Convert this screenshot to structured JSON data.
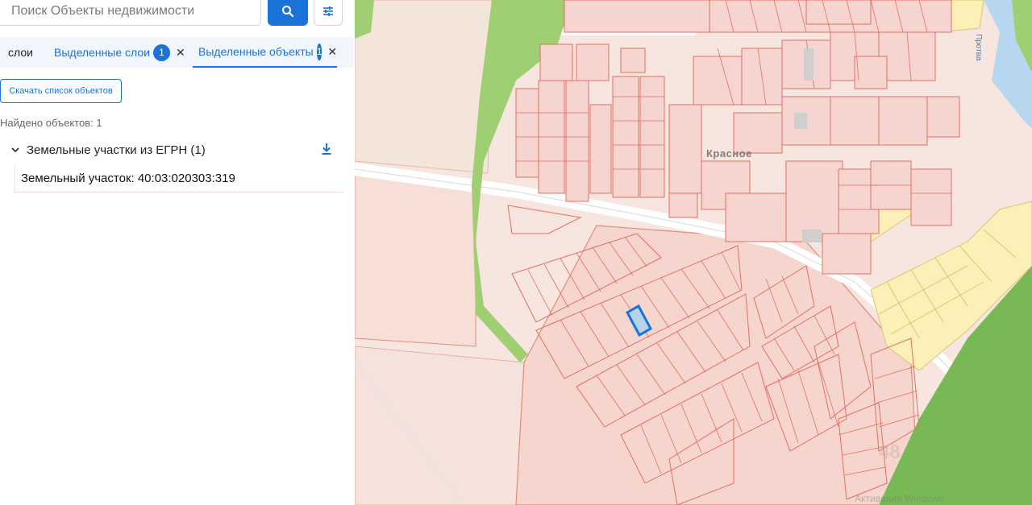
{
  "search": {
    "placeholder": "Поиск Объекты недвижимости"
  },
  "tabs": [
    {
      "label": "слои"
    },
    {
      "label": "Выделенные слои",
      "badge": "1"
    },
    {
      "label": "Выделенные объекты",
      "badge": "1"
    }
  ],
  "actions": {
    "download_list_label": "Скачать список объектов"
  },
  "results": {
    "found_text": "Найдено объектов: 1",
    "group": {
      "title": "Земельные участки из ЕГРН (1)"
    },
    "items": [
      {
        "label": "Земельный участок: 40:03:020303:319"
      }
    ]
  },
  "map": {
    "place_label": "Красное",
    "river_label": "Протва",
    "watermark": "48",
    "attribution": "Активация Windows"
  },
  "colors": {
    "accent": "#1a73d9",
    "parcel_fill": "#f7ddd8",
    "parcel_stroke": "#e07060",
    "yellow_fill": "#fbf0b8",
    "forest": "#8cc765",
    "water": "#b7d7f0",
    "selected": "#1a73d9"
  }
}
